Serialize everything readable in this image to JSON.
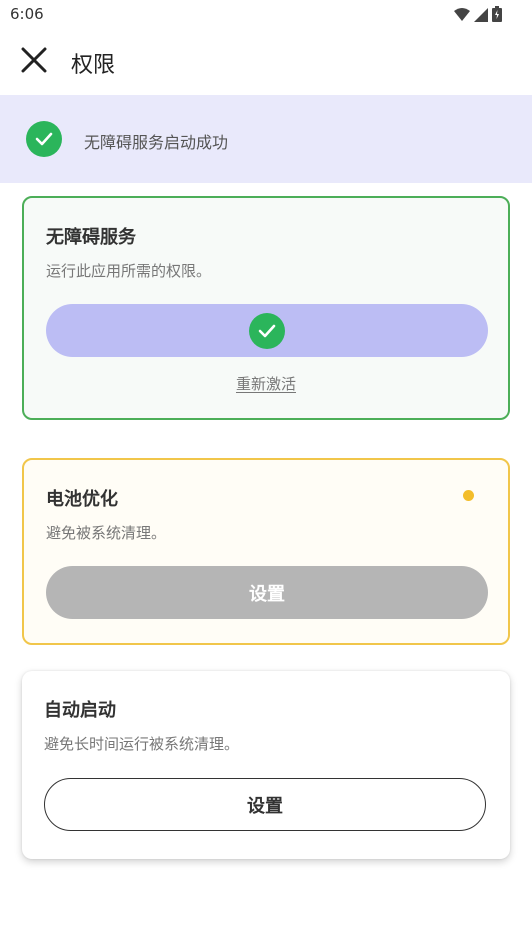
{
  "status_bar": {
    "time": "6:06",
    "icons": [
      "wifi-icon",
      "signal-icon",
      "battery-icon"
    ]
  },
  "app_bar": {
    "title": "权限",
    "close_icon": "close-icon"
  },
  "banner": {
    "icon": "check-circle-icon",
    "message": "无障碍服务启动成功"
  },
  "cards": {
    "accessibility": {
      "title": "无障碍服务",
      "description": "运行此应用所需的权限。",
      "status_icon": "check-circle-icon",
      "reactivate_label": "重新激活"
    },
    "battery": {
      "title": "电池优化",
      "description": "避免被系统清理。",
      "button_label": "设置",
      "indicator_color": "#f3bd2a"
    },
    "autostart": {
      "title": "自动启动",
      "description": "避免长时间运行被系统清理。",
      "button_label": "设置"
    }
  },
  "colors": {
    "success": "#2bb55b",
    "accent_light": "#bcbdf4",
    "banner_bg": "#e9e9fb",
    "warning": "#f3bd2a",
    "disabled": "#b5b5b5"
  }
}
